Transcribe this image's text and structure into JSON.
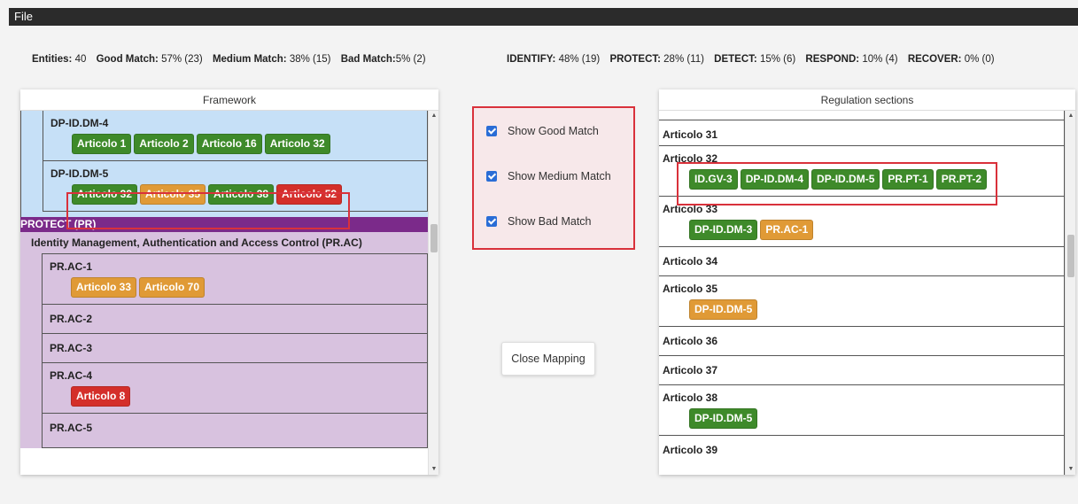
{
  "menu": {
    "file": "File"
  },
  "stats": {
    "entities_label": "Entities:",
    "entities_value": "40",
    "good_label": "Good Match:",
    "good_value": "57% (23)",
    "medium_label": "Medium Match:",
    "medium_value": "38% (15)",
    "bad_label": "Bad Match:",
    "bad_value": "5% (2)",
    "identify_label": "IDENTIFY:",
    "identify_value": "48% (19)",
    "protect_label": "PROTECT:",
    "protect_value": "28% (11)",
    "detect_label": "DETECT:",
    "detect_value": "15% (6)",
    "respond_label": "RESPOND:",
    "respond_value": "10% (4)",
    "recover_label": "RECOVER:",
    "recover_value": "0% (0)"
  },
  "framework": {
    "title": "Framework",
    "dm4": {
      "name": "DP-ID.DM-4",
      "badges": [
        "Articolo 1",
        "Articolo 2",
        "Articolo 16",
        "Articolo 32"
      ]
    },
    "dm5": {
      "name": "DP-ID.DM-5",
      "badges": [
        "Articolo 32",
        "Articolo 35",
        "Articolo 38",
        "Articolo 52"
      ]
    },
    "function": "PROTECT (PR)",
    "category": "Identity Management, Authentication and Access Control (PR.AC)",
    "ac1": {
      "name": "PR.AC-1",
      "badges": [
        "Articolo 33",
        "Articolo 70"
      ]
    },
    "ac2": {
      "name": "PR.AC-2"
    },
    "ac3": {
      "name": "PR.AC-3"
    },
    "ac4": {
      "name": "PR.AC-4",
      "badges": [
        "Articolo 8"
      ]
    },
    "ac5": {
      "name": "PR.AC-5"
    }
  },
  "filters": {
    "good": "Show Good Match",
    "medium": "Show Medium Match",
    "bad": "Show Bad Match"
  },
  "close_mapping": "Close Mapping",
  "regulations": {
    "title": "Regulation sections",
    "a31": {
      "name": "Articolo 31"
    },
    "a32": {
      "name": "Articolo 32",
      "badges": [
        "ID.GV-3",
        "DP-ID.DM-4",
        "DP-ID.DM-5",
        "PR.PT-1",
        "PR.PT-2"
      ]
    },
    "a33": {
      "name": "Articolo 33",
      "badges": [
        "DP-ID.DM-3",
        "PR.AC-1"
      ]
    },
    "a34": {
      "name": "Articolo 34"
    },
    "a35": {
      "name": "Articolo 35",
      "badges": [
        "DP-ID.DM-5"
      ]
    },
    "a36": {
      "name": "Articolo 36"
    },
    "a37": {
      "name": "Articolo 37"
    },
    "a38": {
      "name": "Articolo 38",
      "badges": [
        "DP-ID.DM-5"
      ]
    },
    "a39": {
      "name": "Articolo 39"
    }
  },
  "colors": {
    "good": "#3e8a2a",
    "medium": "#e09a36",
    "bad": "#d42f2a",
    "protect": "#7b2a8a",
    "identify_bg": "#c6e0f7",
    "protect_bg": "#d8c2df",
    "highlight": "#d9313b"
  }
}
